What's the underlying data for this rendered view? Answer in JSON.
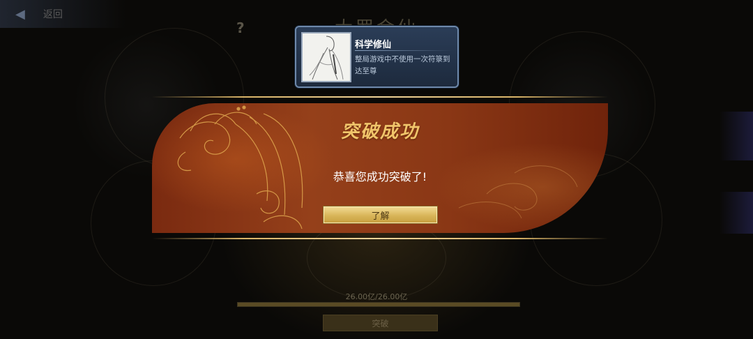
{
  "nav": {
    "back_label": "返回",
    "back_icon": "back-arrow-icon",
    "help_label": "?"
  },
  "background": {
    "title": "大罗金仙",
    "progress_label": "26.00亿/26.00亿",
    "progress_fraction": 1.0,
    "action_label": "突破"
  },
  "achievement": {
    "title": "科学修仙",
    "description": "整局游戏中不使用一次符箓到达至尊",
    "icon": "character-sketch-icon"
  },
  "dialog": {
    "title": "突破成功",
    "message": "恭喜您成功突破了!",
    "confirm_label": "了解"
  },
  "colors": {
    "dialog_red": "#8a3715",
    "gold_text": "#f0c46a",
    "toast_blue": "#2b3d57"
  }
}
